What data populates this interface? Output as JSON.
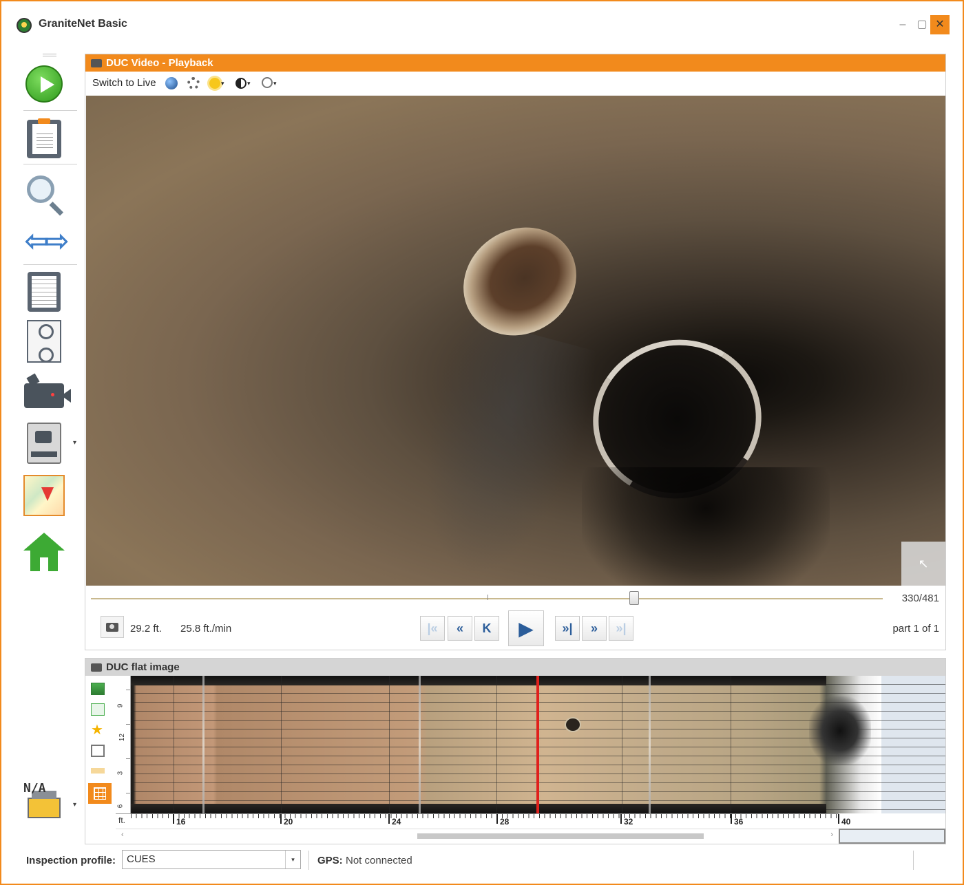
{
  "app": {
    "title": "GraniteNet Basic",
    "accent_color": "#f28a1c",
    "window_controls": [
      "minimize",
      "maximize",
      "close"
    ]
  },
  "left_toolbar": {
    "items": [
      {
        "icon": "play-icon"
      },
      {
        "icon": "clipboard-icon"
      },
      {
        "icon": "search-icon"
      },
      {
        "icon": "swap-arrows-icon"
      },
      {
        "icon": "report-sheet-icon"
      },
      {
        "icon": "pipe-segment-icon"
      },
      {
        "icon": "video-camera-icon"
      },
      {
        "icon": "camera-print-icon"
      },
      {
        "icon": "map-icon"
      },
      {
        "icon": "home-icon"
      },
      {
        "icon": "measure-tool-icon"
      }
    ],
    "status_label": "N/A"
  },
  "video_panel": {
    "title": "DUC Video - Playback",
    "toolbar": {
      "switch_label": "Switch to Live",
      "icons": [
        "globe-icon",
        "settings-gear-icon",
        "brightness-icon",
        "contrast-icon",
        "zoom-icon"
      ]
    },
    "frame_counter": "330/481",
    "seek_progress": 0.686,
    "distance": "29.2 ft.",
    "speed": "25.8 ft./min",
    "part_label": "part 1 of 1",
    "nav_buttons": [
      {
        "icon": "first-frame-icon",
        "glyph": "|«",
        "enabled": false
      },
      {
        "icon": "fast-rewind-icon",
        "glyph": "«",
        "enabled": true
      },
      {
        "icon": "step-back-icon",
        "glyph": "K",
        "enabled": true
      },
      {
        "icon": "play-icon",
        "glyph": "▶",
        "enabled": true
      },
      {
        "icon": "step-forward-icon",
        "glyph": "»|",
        "enabled": true
      },
      {
        "icon": "fast-forward-icon",
        "glyph": "»",
        "enabled": true
      },
      {
        "icon": "last-frame-icon",
        "glyph": "»|",
        "enabled": false
      }
    ]
  },
  "flat_panel": {
    "title": "DUC flat image",
    "clock_labels": [
      "9",
      "12",
      "3",
      "6"
    ],
    "ft_unit": "ft.",
    "ft_labels": [
      "16",
      "20",
      "24",
      "28",
      "32",
      "36",
      "40"
    ],
    "marker_position_ft": 29.2
  },
  "status_bar": {
    "inspection_profile_label": "Inspection profile:",
    "inspection_profile_value": "CUES",
    "gps_label": "GPS:",
    "gps_value": "Not connected"
  }
}
